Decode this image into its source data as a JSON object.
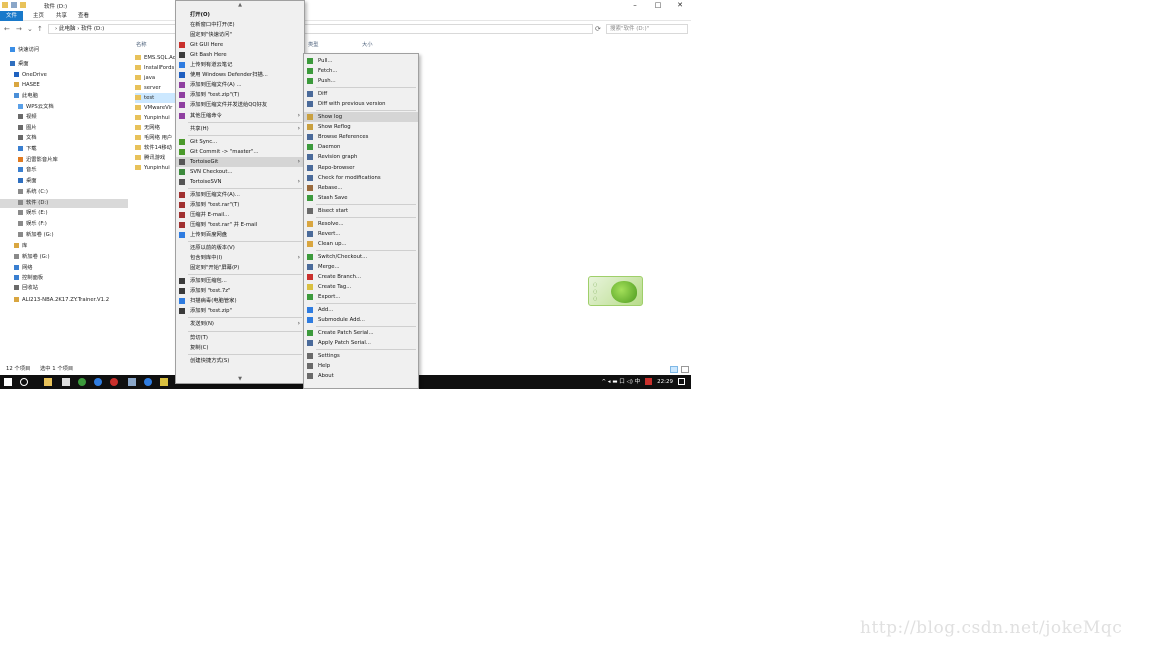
{
  "window": {
    "title": "软件 (D:)",
    "buttons": {
      "minimize": "–",
      "maximize": "□",
      "close": "✕"
    }
  },
  "ribbon": {
    "tabs": [
      "文件",
      "主页",
      "共享",
      "查看"
    ]
  },
  "address": {
    "back": "←",
    "forward": "→",
    "down": "⌄",
    "up": "↑",
    "path": "› 此电脑 › 软件 (D:)",
    "refresh": "⟳",
    "search_placeholder": "搜索\"软件 (D:)\""
  },
  "navpane": {
    "items": [
      {
        "label": "快速访问",
        "color": "#3a8ee6"
      },
      {
        "label": "桌面",
        "color": "#2f6fbf"
      },
      {
        "label": "OneDrive",
        "color": "#1f62c0"
      },
      {
        "label": "HASEE",
        "color": "#d9a640"
      },
      {
        "label": "此电脑",
        "color": "#4a8fd8"
      },
      {
        "label": "WPS云文档",
        "color": "#5aa0e8"
      },
      {
        "label": "视频",
        "color": "#6a6a6a"
      },
      {
        "label": "图片",
        "color": "#6a6a6a"
      },
      {
        "label": "文档",
        "color": "#6a6a6a"
      },
      {
        "label": "下载",
        "color": "#3a7fd0"
      },
      {
        "label": "迅雷影音片库",
        "color": "#e07a20"
      },
      {
        "label": "音乐",
        "color": "#3a7fd0"
      },
      {
        "label": "桌面",
        "color": "#2f6fbf"
      },
      {
        "label": "系统 (C:)",
        "color": "#8a8a8a"
      },
      {
        "label": "软件 (D:)",
        "color": "#8a8a8a",
        "selected": true
      },
      {
        "label": "娱乐 (E:)",
        "color": "#8a8a8a"
      },
      {
        "label": "娱乐 (F:)",
        "color": "#8a8a8a"
      },
      {
        "label": "新加卷 (G:)",
        "color": "#8a8a8a"
      },
      {
        "label": "库",
        "color": "#d9a640"
      },
      {
        "label": "新加卷 (G:)",
        "color": "#8a8a8a"
      },
      {
        "label": "网络",
        "color": "#3a7fd0"
      },
      {
        "label": "控制面板",
        "color": "#3a7fd0"
      },
      {
        "label": "回收站",
        "color": "#6a6a6a"
      },
      {
        "label": "ALI213-NBA.2K17.ZY.Trainer.V1.2",
        "color": "#d9a640"
      }
    ]
  },
  "filelist": {
    "columns": {
      "name": "名称",
      "type": "类型",
      "size": "大小"
    },
    "rows": [
      {
        "name": "EMS.SQL.Ac"
      },
      {
        "name": "InstallFords"
      },
      {
        "name": "java"
      },
      {
        "name": "server"
      },
      {
        "name": "test",
        "selected": true
      },
      {
        "name": "VMwareVir"
      },
      {
        "name": "Yunpinhui"
      },
      {
        "name": "无网络"
      },
      {
        "name": "毛网络 用户"
      },
      {
        "name": "软件14移动"
      },
      {
        "name": "腾讯游戏"
      },
      {
        "name": "Yunpinhui"
      }
    ]
  },
  "statusbar": {
    "count": "12 个项目",
    "selected": "选中 1 个项目"
  },
  "taskbar": {
    "time": "22:29",
    "tray_text": "^ ◂ ▬ 口 ◁) 中"
  },
  "mainmenu": {
    "items": [
      {
        "label": "打开(O)",
        "bold": true
      },
      {
        "label": "在新窗口中打开(E)"
      },
      {
        "label": "固定到\"快速访问\""
      },
      {
        "label": "Git GUI Here",
        "icon": "#c9302c"
      },
      {
        "label": "Git Bash Here",
        "icon": "#3c3c3c"
      },
      {
        "label": "上传到有道云笔记",
        "icon": "#2f7ce0"
      },
      {
        "label": "使用 Windows Defender扫描...",
        "icon": "#1f5fc0"
      },
      {
        "label": "添加到压缩文件(A) ...",
        "icon": "#8f3fa0"
      },
      {
        "label": "添加到 \"test.zip\"(T)",
        "icon": "#8f3fa0"
      },
      {
        "label": "添加到压缩文件并发送给QQ好友",
        "icon": "#8f3fa0"
      },
      {
        "label": "其他压缩命令",
        "icon": "#8f3fa0",
        "arrow": true
      },
      {
        "label": "共享(H)",
        "arrow": true
      },
      {
        "label": "Git Sync...",
        "icon": "#4a9a2a"
      },
      {
        "label": "Git Commit -> \"master\"...",
        "icon": "#4a9a2a"
      },
      {
        "label": "TortoiseGit",
        "icon": "#555",
        "arrow": true,
        "highlight": true
      },
      {
        "label": "SVN Checkout...",
        "icon": "#3c8a3c"
      },
      {
        "label": "TortoiseSVN",
        "icon": "#555",
        "arrow": true
      },
      {
        "label": "添加到压缩文件(A)...",
        "icon": "#a03030"
      },
      {
        "label": "添加到 \"test.rar\"(T)",
        "icon": "#a03030"
      },
      {
        "label": "压缩并 E-mail...",
        "icon": "#a03030"
      },
      {
        "label": "压缩到 \"test.rar\" 并 E-mail",
        "icon": "#a03030"
      },
      {
        "label": "上传到百度网盘",
        "icon": "#2f7ce0"
      },
      {
        "label": "还原以前的版本(V)"
      },
      {
        "label": "包含到库中(I)",
        "arrow": true
      },
      {
        "label": "固定到\"开始\"屏幕(P)"
      },
      {
        "label": "添加到压缩包...",
        "icon": "#3a3a3a"
      },
      {
        "label": "添加到 \"test.7z\"",
        "icon": "#3a3a3a"
      },
      {
        "label": "扫描病毒(电脑管家)",
        "icon": "#2f7ce0"
      },
      {
        "label": "添加到 \"test.zip\"",
        "icon": "#3a3a3a"
      },
      {
        "label": "发送到(N)",
        "arrow": true
      },
      {
        "label": "剪切(T)"
      },
      {
        "label": "复制(C)"
      },
      {
        "label": "创建快捷方式(S)"
      }
    ]
  },
  "gitmenu": {
    "items": [
      {
        "label": "Pull...",
        "icon": "#3c9a3c"
      },
      {
        "label": "Fetch...",
        "icon": "#3c9a3c"
      },
      {
        "label": "Push...",
        "icon": "#3c9a3c"
      },
      {
        "label": "Diff",
        "icon": "#4a6a9a"
      },
      {
        "label": "Diff with previous version",
        "icon": "#4a6a9a"
      },
      {
        "label": "Show log",
        "icon": "#c9a040",
        "highlight": true
      },
      {
        "label": "Show Reflog",
        "icon": "#c9a040"
      },
      {
        "label": "Browse References",
        "icon": "#4a6a9a"
      },
      {
        "label": "Daemon",
        "icon": "#3c9a3c"
      },
      {
        "label": "Revision graph",
        "icon": "#4a6a9a"
      },
      {
        "label": "Repo-browser",
        "icon": "#4a6a9a"
      },
      {
        "label": "Check for modifications",
        "icon": "#4a6a9a"
      },
      {
        "label": "Rebase...",
        "icon": "#9a6a3c"
      },
      {
        "label": "Stash Save",
        "icon": "#3c9a3c"
      },
      {
        "label": "Bisect start",
        "icon": "#6a6a6a"
      },
      {
        "label": "Resolve...",
        "icon": "#d9a640"
      },
      {
        "label": "Revert...",
        "icon": "#4a6a9a"
      },
      {
        "label": "Clean up...",
        "icon": "#d9a640"
      },
      {
        "label": "Switch/Checkout...",
        "icon": "#3c9a3c"
      },
      {
        "label": "Merge...",
        "icon": "#4a6a9a"
      },
      {
        "label": "Create Branch...",
        "icon": "#c9302c"
      },
      {
        "label": "Create Tag...",
        "icon": "#d9c040"
      },
      {
        "label": "Export...",
        "icon": "#3c9a3c"
      },
      {
        "label": "Add...",
        "icon": "#2f7ce0"
      },
      {
        "label": "Submodule Add...",
        "icon": "#2f7ce0"
      },
      {
        "label": "Create Patch Serial...",
        "icon": "#3c9a3c"
      },
      {
        "label": "Apply Patch Serial...",
        "icon": "#4a6a9a"
      },
      {
        "label": "Settings",
        "icon": "#6a6a6a"
      },
      {
        "label": "Help",
        "icon": "#6a6a6a"
      },
      {
        "label": "About",
        "icon": "#6a6a6a"
      }
    ]
  },
  "watermark": "http://blog.csdn.net/jokeMqc"
}
